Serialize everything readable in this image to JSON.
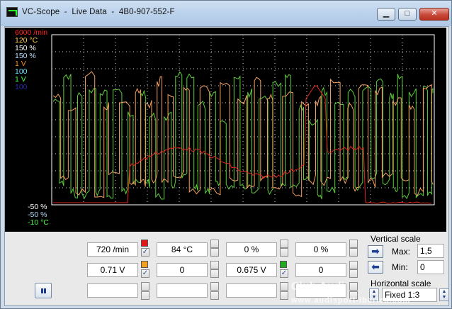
{
  "window": {
    "title": "VC-Scope  -  Live Data  -  4B0-907-552-F",
    "min_glyph": "▁",
    "max_glyph": "□",
    "close_glyph": "✕"
  },
  "scope": {
    "scale_labels_top": [
      {
        "text": "6000 /min",
        "color": "#ff2020"
      },
      {
        "text": "120 °C",
        "color": "#ffcc44"
      },
      {
        "text": "150 %",
        "color": "#ffffff"
      },
      {
        "text": "150 %",
        "color": "#b8dcff"
      },
      {
        "text": "1 V",
        "color": "#ff8c1a"
      },
      {
        "text": "100",
        "color": "#66e0ff"
      },
      {
        "text": "1 V",
        "color": "#44ff44"
      },
      {
        "text": "100",
        "color": "#2b2bb0"
      }
    ],
    "scale_labels_bottom": [
      {
        "text": "-50 %",
        "color": "#ffffff"
      },
      {
        "text": "-50 %",
        "color": "#b8dcff"
      },
      {
        "text": "-10 °C",
        "color": "#44ff44"
      }
    ],
    "series": [
      {
        "name": "rpm",
        "color": "#e0261f"
      },
      {
        "name": "voltage_1",
        "color": "#f5a060"
      },
      {
        "name": "voltage_2",
        "color": "#5ccf3a"
      }
    ]
  },
  "channels": {
    "row1": [
      {
        "value": "720 /min",
        "swatch": "#e01818",
        "checked": true
      },
      {
        "value": "84 °C",
        "swatch": "",
        "checked": false
      },
      {
        "value": "0 %",
        "swatch": "",
        "checked": false
      },
      {
        "value": "0 %",
        "swatch": "",
        "checked": false
      }
    ],
    "row2": [
      {
        "value": "0.71 V",
        "swatch": "#f0a020",
        "checked": true
      },
      {
        "value": "0",
        "swatch": "",
        "checked": false
      },
      {
        "value": "0.675 V",
        "swatch": "#22aa22",
        "checked": true
      },
      {
        "value": "0",
        "swatch": "",
        "checked": false
      }
    ],
    "row3": [
      {
        "value": "",
        "swatch": "",
        "checked": false
      },
      {
        "value": "",
        "swatch": "",
        "checked": false
      },
      {
        "value": "",
        "swatch": "",
        "checked": false
      },
      {
        "value": "",
        "swatch": "",
        "checked": false
      }
    ]
  },
  "vertical_scale": {
    "title": "Vertical scale",
    "max_label": "Max:",
    "max_value": "1,5",
    "min_label": "Min:",
    "min_value": "0"
  },
  "horizontal_scale": {
    "title": "Horizontal scale",
    "value": "Fixed 1:3"
  },
  "watermark": {
    "line1": "Club Audi",
    "line2": "www.audisport-iberica.com"
  }
}
